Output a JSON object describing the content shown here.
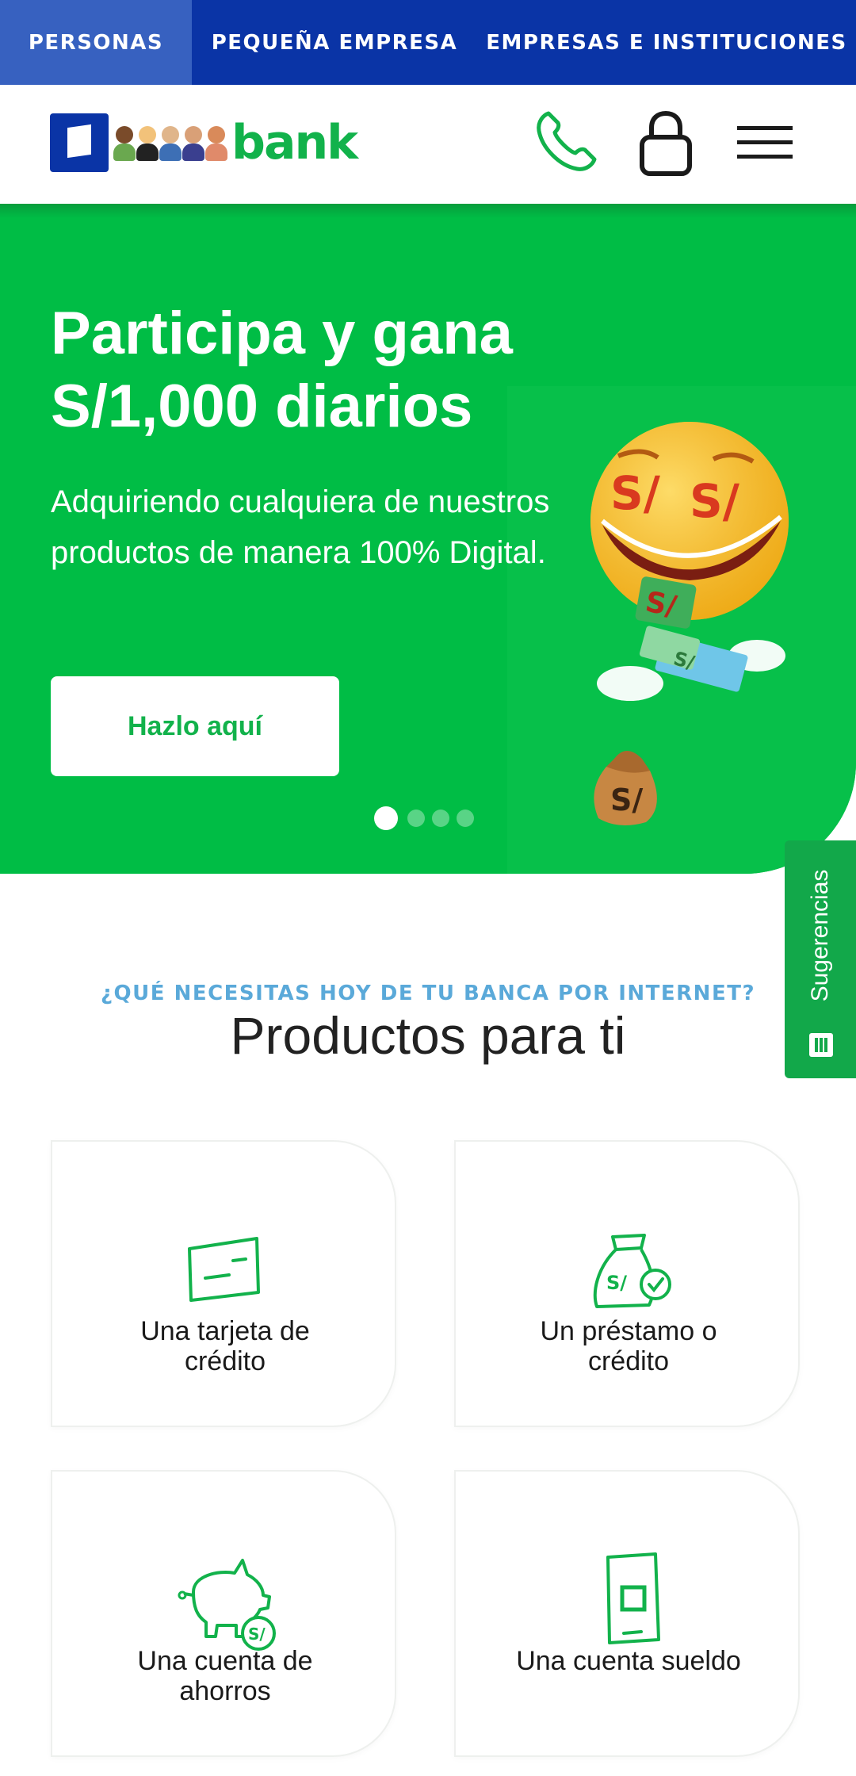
{
  "topnav": {
    "tabs": [
      {
        "label": "PERSONAS",
        "active": true
      },
      {
        "label": "PEQUEÑA EMPRESA",
        "active": false
      },
      {
        "label": "EMPRESAS E INSTITUCIONES",
        "active": false
      }
    ]
  },
  "header": {
    "logo_text": "bank",
    "icons": [
      "phone-icon",
      "lock-icon",
      "menu-icon"
    ]
  },
  "hero": {
    "title_line1": "Participa y gana",
    "title_line2": "S/1,000 diarios",
    "subtitle": "Adquiriendo cualquiera de nuestros productos de manera 100% Digital.",
    "cta_label": "Hazlo aquí",
    "carousel": {
      "total": 4,
      "active": 1
    }
  },
  "feedback_tab": {
    "label": "Sugerencias"
  },
  "products": {
    "eyebrow": "¿QUÉ NECESITAS HOY DE TU BANCA POR INTERNET?",
    "title": "Productos para ti",
    "items": [
      {
        "label_line1": "Una tarjeta de",
        "label_line2": "crédito",
        "icon": "credit-card-icon"
      },
      {
        "label_line1": "Un préstamo o",
        "label_line2": "crédito",
        "icon": "money-bag-icon"
      },
      {
        "label_line1": "Una cuenta de",
        "label_line2": "ahorros",
        "icon": "piggy-bank-icon"
      },
      {
        "label_line1": "Una cuenta sueldo",
        "label_line2": "",
        "icon": "mobile-phone-icon"
      }
    ]
  },
  "colors": {
    "brand_blue": "#0a34a6",
    "brand_green": "#12b24b",
    "hero_green": "#00bd45",
    "eyebrow_blue": "#5aa9d9"
  }
}
